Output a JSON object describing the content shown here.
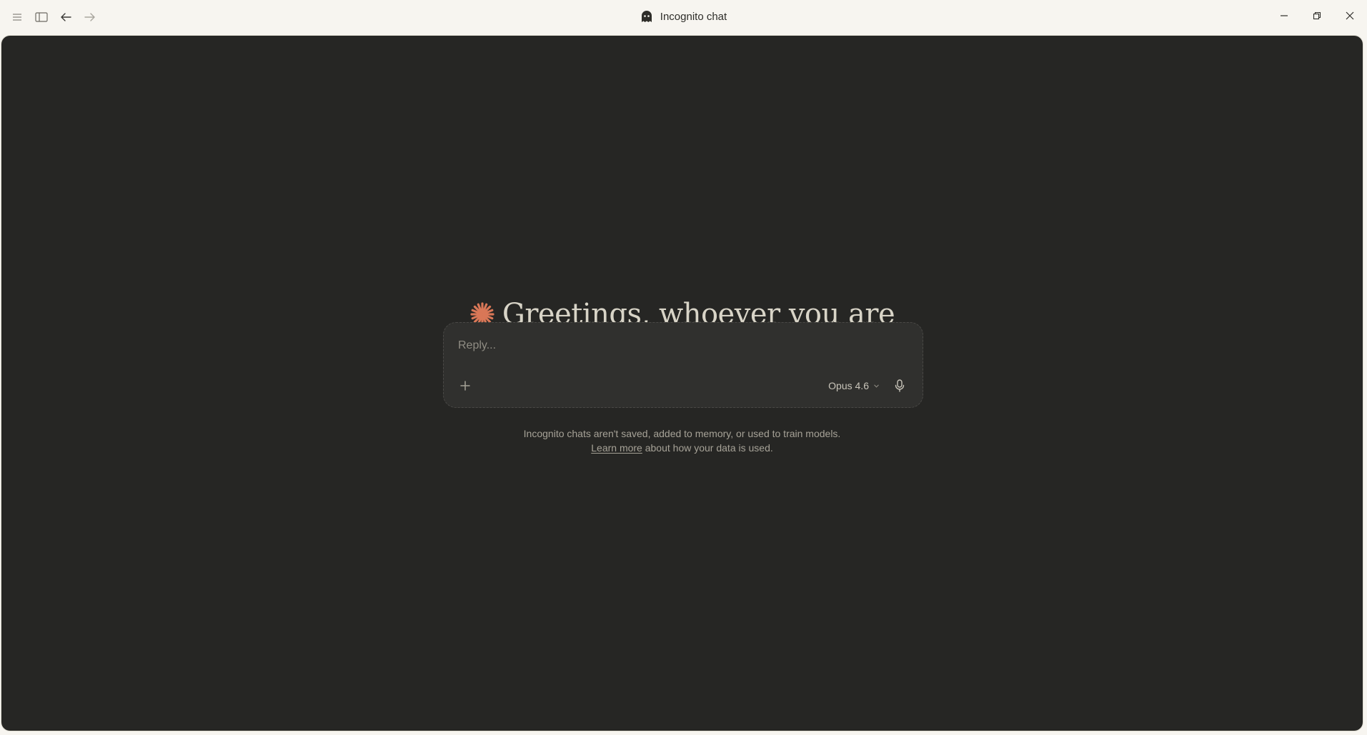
{
  "window": {
    "title": "Incognito chat",
    "icons": {
      "menu": "menu-icon",
      "sidebar": "sidebar-toggle-icon",
      "back": "arrow-left-icon",
      "forward": "arrow-right-icon",
      "title": "ghost-icon",
      "minimize": "minimize-icon",
      "restore": "restore-icon",
      "close": "close-icon"
    }
  },
  "greeting": {
    "text": "Greetings, whoever you are",
    "icon": "asterisk-spark-icon",
    "accent_color": "#d97757"
  },
  "composer": {
    "placeholder": "Reply...",
    "value": "",
    "add_icon": "plus-icon",
    "model_label": "Opus 4.6",
    "model_icon": "chevron-down-icon",
    "mic_icon": "microphone-icon"
  },
  "notice": {
    "line1": "Incognito chats aren't saved, added to memory, or used to train models.",
    "link_text": "Learn more",
    "line2_rest": " about how your data is used."
  },
  "colors": {
    "titlebar_bg": "#f7f5f0",
    "main_bg": "#262624",
    "composer_bg": "#30302e",
    "text_primary": "#d8d4c7",
    "text_muted": "#a6a297"
  }
}
